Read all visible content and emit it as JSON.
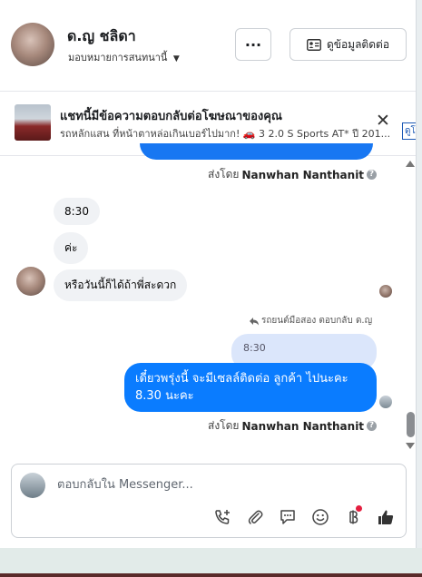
{
  "header": {
    "name": "ด.ญ ชลิดา",
    "assign_label": "มอบหมายการสนทนานี้",
    "more_label": "···",
    "contact_label": "ดูข้อมูลติดต่อ"
  },
  "ad_banner": {
    "title": "แชทนี้มีข้อความตอบกลับต่อโฆษณาของคุณ",
    "subtitle": "รถหลักแสน ที่หน้าตาหล่อเกินเบอร์ไปมาก! 🚗 3 2.0 S Sports AT* ปี 201...",
    "link_label": "ดูโ"
  },
  "messages": {
    "sent_by_prefix": "ส่งโดย",
    "sender": "Nanwhan Nanthanit",
    "help": "?",
    "in_1": "8:30",
    "in_2": "ค่ะ",
    "in_3": "หรือวันนี้ก็ได้ถ้าพี่สะดวก",
    "reply_meta": "รถยนต์มือสอง ตอบกลับ ด.ญ",
    "quoted": "8:30",
    "out_1": "เดี๋ยวพรุ่งนี้ จะมีเซลล์ติดต่อ ลูกค้า ไปนะคะ 8.30 นะคะ"
  },
  "composer": {
    "placeholder": "ตอบกลับใน Messenger..."
  },
  "colors": {
    "accent": "#0a7cff",
    "incoming_bg": "#f0f2f5",
    "quoted_bg": "#dbe6fb"
  }
}
